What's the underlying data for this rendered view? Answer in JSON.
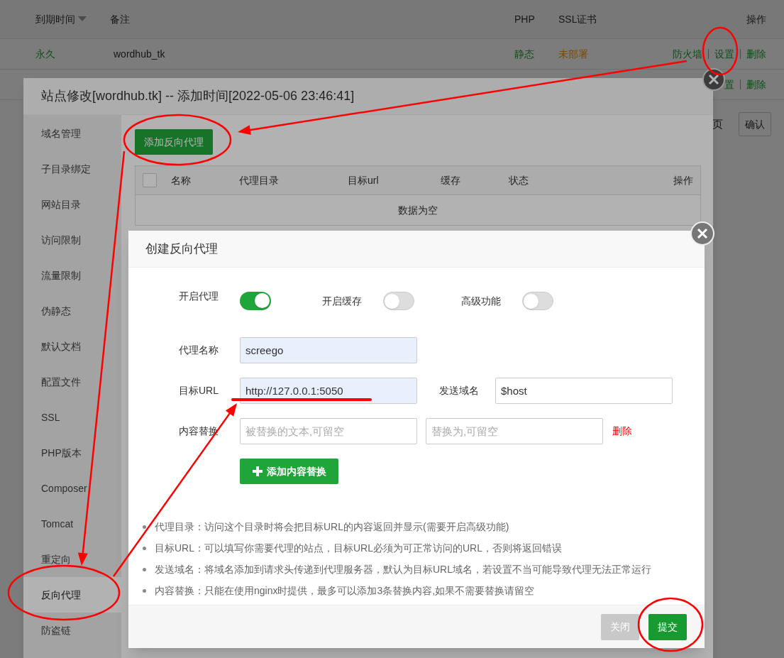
{
  "background_page": {
    "columns": [
      {
        "label": "到期时间",
        "sorted": true
      },
      {
        "label": "备注",
        "sorted": false
      },
      {
        "label": "PHP",
        "sorted": false
      },
      {
        "label": "SSL证书",
        "sorted": false
      },
      {
        "label": "操作",
        "sorted": false
      }
    ],
    "rows": [
      {
        "expiry": "永久",
        "note": "wordhub_tk",
        "php": "静态",
        "ssl": "未部署",
        "actions": [
          "防火墙",
          "设置",
          "删除"
        ]
      },
      {
        "actions": [
          "置",
          "删除"
        ]
      }
    ],
    "page_label": "页",
    "confirm_button": "确认"
  },
  "site_modal": {
    "title": "站点修改[wordhub.tk] -- 添加时间[2022-05-06 23:46:41]",
    "sidebar": [
      {
        "label": "域名管理",
        "selected": false
      },
      {
        "label": "子目录绑定",
        "selected": false
      },
      {
        "label": "网站目录",
        "selected": false
      },
      {
        "label": "访问限制",
        "selected": false
      },
      {
        "label": "流量限制",
        "selected": false
      },
      {
        "label": "伪静态",
        "selected": false
      },
      {
        "label": "默认文档",
        "selected": false
      },
      {
        "label": "配置文件",
        "selected": false
      },
      {
        "label": "SSL",
        "selected": false
      },
      {
        "label": "PHP版本",
        "selected": false
      },
      {
        "label": "Composer",
        "selected": false
      },
      {
        "label": "Tomcat",
        "selected": false
      },
      {
        "label": "重定向",
        "selected": false
      },
      {
        "label": "反向代理",
        "selected": true
      },
      {
        "label": "防盗链",
        "selected": false
      }
    ],
    "add_button": "添加反向代理",
    "table": {
      "select_all_checked": false,
      "columns": [
        "名称",
        "代理目录",
        "目标url",
        "缓存",
        "状态",
        "操作"
      ],
      "empty_text": "数据为空"
    }
  },
  "dialog": {
    "title": "创建反向代理",
    "toggles": [
      {
        "label": "开启代理",
        "on": true
      },
      {
        "label": "开启缓存",
        "on": false
      },
      {
        "label": "高级功能",
        "on": false
      }
    ],
    "rows": [
      {
        "items": [
          {
            "kind": "label",
            "text": "代理名称"
          },
          {
            "kind": "input",
            "value": "screego",
            "autofilled": true
          }
        ]
      },
      {
        "items": [
          {
            "kind": "label",
            "text": "目标URL"
          },
          {
            "kind": "input",
            "value": "http://127.0.0.1:5050",
            "autofilled": true
          },
          {
            "kind": "label",
            "text": "发送域名"
          },
          {
            "kind": "input",
            "value": "$host",
            "autofilled": false
          }
        ]
      },
      {
        "items": [
          {
            "kind": "label",
            "text": "内容替换"
          },
          {
            "kind": "input",
            "placeholder": "被替换的文本,可留空",
            "autofilled": false
          },
          {
            "kind": "input",
            "placeholder": "替换为,可留空",
            "autofilled": false
          },
          {
            "kind": "link",
            "text": "删除"
          }
        ]
      }
    ],
    "add_replace_button": "添加内容替换",
    "notes": [
      "代理目录：访问这个目录时将会把目标URL的内容返回并显示(需要开启高级功能)",
      "目标URL：可以填写你需要代理的站点，目标URL必须为可正常访问的URL，否则将返回错误",
      "发送域名：将域名添加到请求头传递到代理服务器，默认为目标URL域名，若设置不当可能导致代理无法正常运行",
      "内容替换：只能在使用nginx时提供，最多可以添加3条替换内容,如果不需要替换请留空"
    ],
    "buttons": [
      {
        "label": "关闭",
        "kind": "close",
        "disabled": true
      },
      {
        "label": "提交",
        "kind": "submit",
        "disabled": false
      }
    ]
  }
}
